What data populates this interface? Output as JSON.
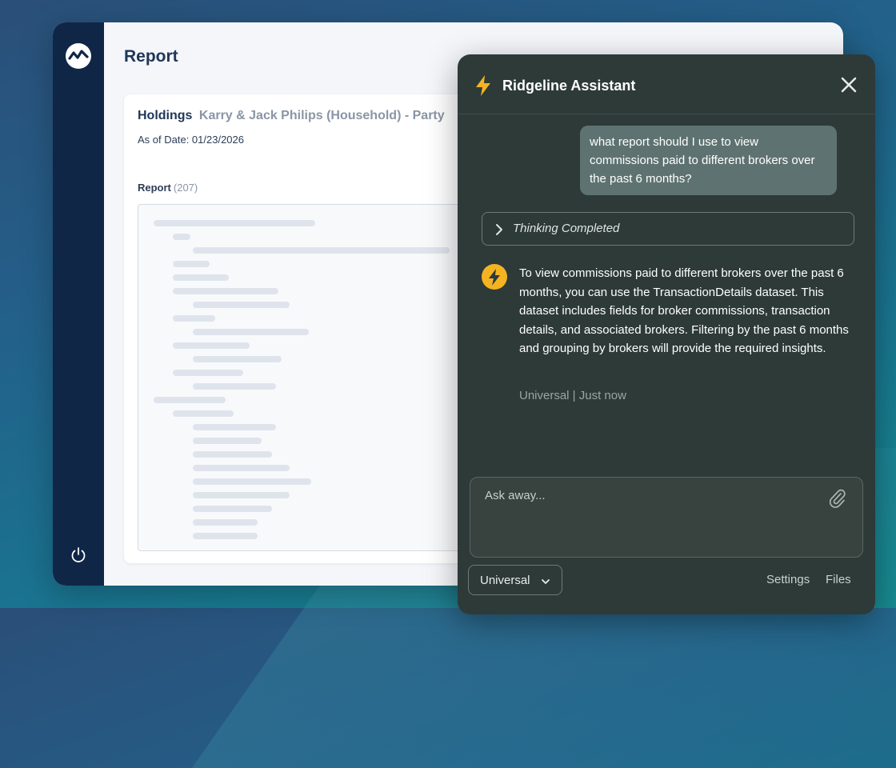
{
  "app": {
    "page_title": "Report",
    "holdings": {
      "label": "Holdings",
      "subtitle": "Karry & Jack Philips (Household) - Party",
      "as_of": "As of Date: 01/23/2026"
    },
    "report": {
      "label": "Report",
      "count": "(207)"
    }
  },
  "assistant": {
    "title": "Ridgeline Assistant",
    "user_message": "what report should I use to view commissions paid to different brokers over the past 6 months?",
    "thinking_label": "Thinking Completed",
    "bot_message": "To view commissions paid to different brokers over the past 6 months, you can use the TransactionDetails dataset. This dataset includes fields for broker commissions, transaction details, and associated brokers. Filtering by the past 6 months and grouping by brokers will provide the required insights.",
    "meta": "Universal | Just now",
    "input_placeholder": "Ask away...",
    "scope_label": "Universal",
    "settings_label": "Settings",
    "files_label": "Files"
  },
  "colors": {
    "sidebar": "#0f2647",
    "assistant_bg": "#2d3a38",
    "accent": "#f5b322",
    "user_bubble": "#5e7371"
  },
  "icons": [
    "logo-icon",
    "power-icon",
    "bolt-icon",
    "close-icon",
    "chevron-right-icon",
    "paperclip-icon",
    "chevron-down-icon"
  ]
}
